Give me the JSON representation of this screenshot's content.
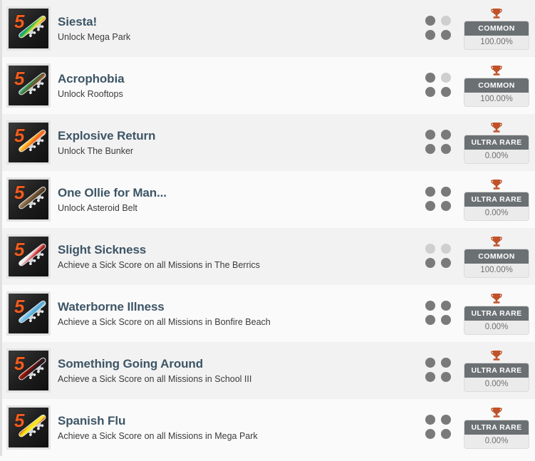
{
  "list": {
    "rarity_colors": {
      "badge_bg": "#6b7073",
      "badge_text": "#ffffff",
      "trophy": "#c0522a",
      "title": "#3d5566",
      "dot_on": "#7a7a7a",
      "dot_off": "#cfcfcf",
      "row_alt_a": "#f2f2f2",
      "row_alt_b": "#fafafa"
    },
    "items": [
      {
        "title": "Siesta!",
        "description": "Unlock Mega Park",
        "rarity": "COMMON",
        "percent": "100.00%",
        "trophy_icon": "trophy-icon",
        "dots": [
          true,
          false,
          true,
          true
        ],
        "icon_name": "achievement-icon-siesta",
        "deck_colors": [
          "#1b8fd0",
          "#22b14c",
          "#f5e63c",
          "#e8412c"
        ],
        "deck_style": "rainbow"
      },
      {
        "title": "Acrophobia",
        "description": "Unlock Rooftops",
        "rarity": "COMMON",
        "percent": "100.00%",
        "trophy_icon": "trophy-icon",
        "dots": [
          true,
          false,
          true,
          true
        ],
        "icon_name": "achievement-icon-acrophobia",
        "deck_colors": [
          "#8fc8ea",
          "#2f8f3e",
          "#7a4a2a",
          "#c8b49a"
        ],
        "deck_style": "landscape"
      },
      {
        "title": "Explosive Return",
        "description": "Unlock The Bunker",
        "rarity": "ULTRA RARE",
        "percent": "0.00%",
        "trophy_icon": "trophy-icon",
        "dots": [
          true,
          true,
          true,
          true
        ],
        "icon_name": "achievement-icon-explosive-return",
        "deck_colors": [
          "#fff0a0",
          "#ffb41e",
          "#f25c1e",
          "#ffd9a0"
        ],
        "deck_style": "fire"
      },
      {
        "title": "One Ollie for Man...",
        "description": "Unlock Asteroid Belt",
        "rarity": "ULTRA RARE",
        "percent": "0.00%",
        "trophy_icon": "trophy-icon",
        "dots": [
          true,
          true,
          true,
          true
        ],
        "icon_name": "achievement-icon-one-ollie-for-man",
        "deck_colors": [
          "#b49a78",
          "#8a6b48",
          "#5a4228",
          "#3a2a18"
        ],
        "deck_style": "asteroid"
      },
      {
        "title": "Slight Sickness",
        "description": "Achieve a Sick Score on all Missions in The Berrics",
        "rarity": "COMMON",
        "percent": "100.00%",
        "trophy_icon": "trophy-icon",
        "dots": [
          false,
          false,
          true,
          true
        ],
        "icon_name": "achievement-icon-slight-sickness",
        "deck_colors": [
          "#ffffff",
          "#efefef",
          "#d42b2b",
          "#1a1a1a"
        ],
        "deck_style": "white"
      },
      {
        "title": "Waterborne Illness",
        "description": "Achieve a Sick Score on all Missions in Bonfire Beach",
        "rarity": "ULTRA RARE",
        "percent": "0.00%",
        "trophy_icon": "trophy-icon",
        "dots": [
          true,
          true,
          true,
          true
        ],
        "icon_name": "achievement-icon-waterborne-illness",
        "deck_colors": [
          "#bfe4f5",
          "#7fc4e8",
          "#4aa3d4",
          "#d8f0fb"
        ],
        "deck_style": "ice"
      },
      {
        "title": "Something Going Around",
        "description": "Achieve a Sick Score on all Missions in School III",
        "rarity": "ULTRA RARE",
        "percent": "0.00%",
        "trophy_icon": "trophy-icon",
        "dots": [
          true,
          true,
          true,
          true
        ],
        "icon_name": "achievement-icon-something-going-around",
        "deck_colors": [
          "#d42b16",
          "#8a1208",
          "#1a1a22",
          "#40121a"
        ],
        "deck_style": "darkred"
      },
      {
        "title": "Spanish Flu",
        "description": "Achieve a Sick Score on all Missions in Mega Park",
        "rarity": "ULTRA RARE",
        "percent": "0.00%",
        "trophy_icon": "trophy-icon",
        "dots": [
          true,
          true,
          true,
          true
        ],
        "icon_name": "achievement-icon-spanish-flu",
        "deck_colors": [
          "#e02d20",
          "#f2e008",
          "#ffe83a",
          "#c41810"
        ],
        "deck_style": "spain"
      }
    ]
  }
}
